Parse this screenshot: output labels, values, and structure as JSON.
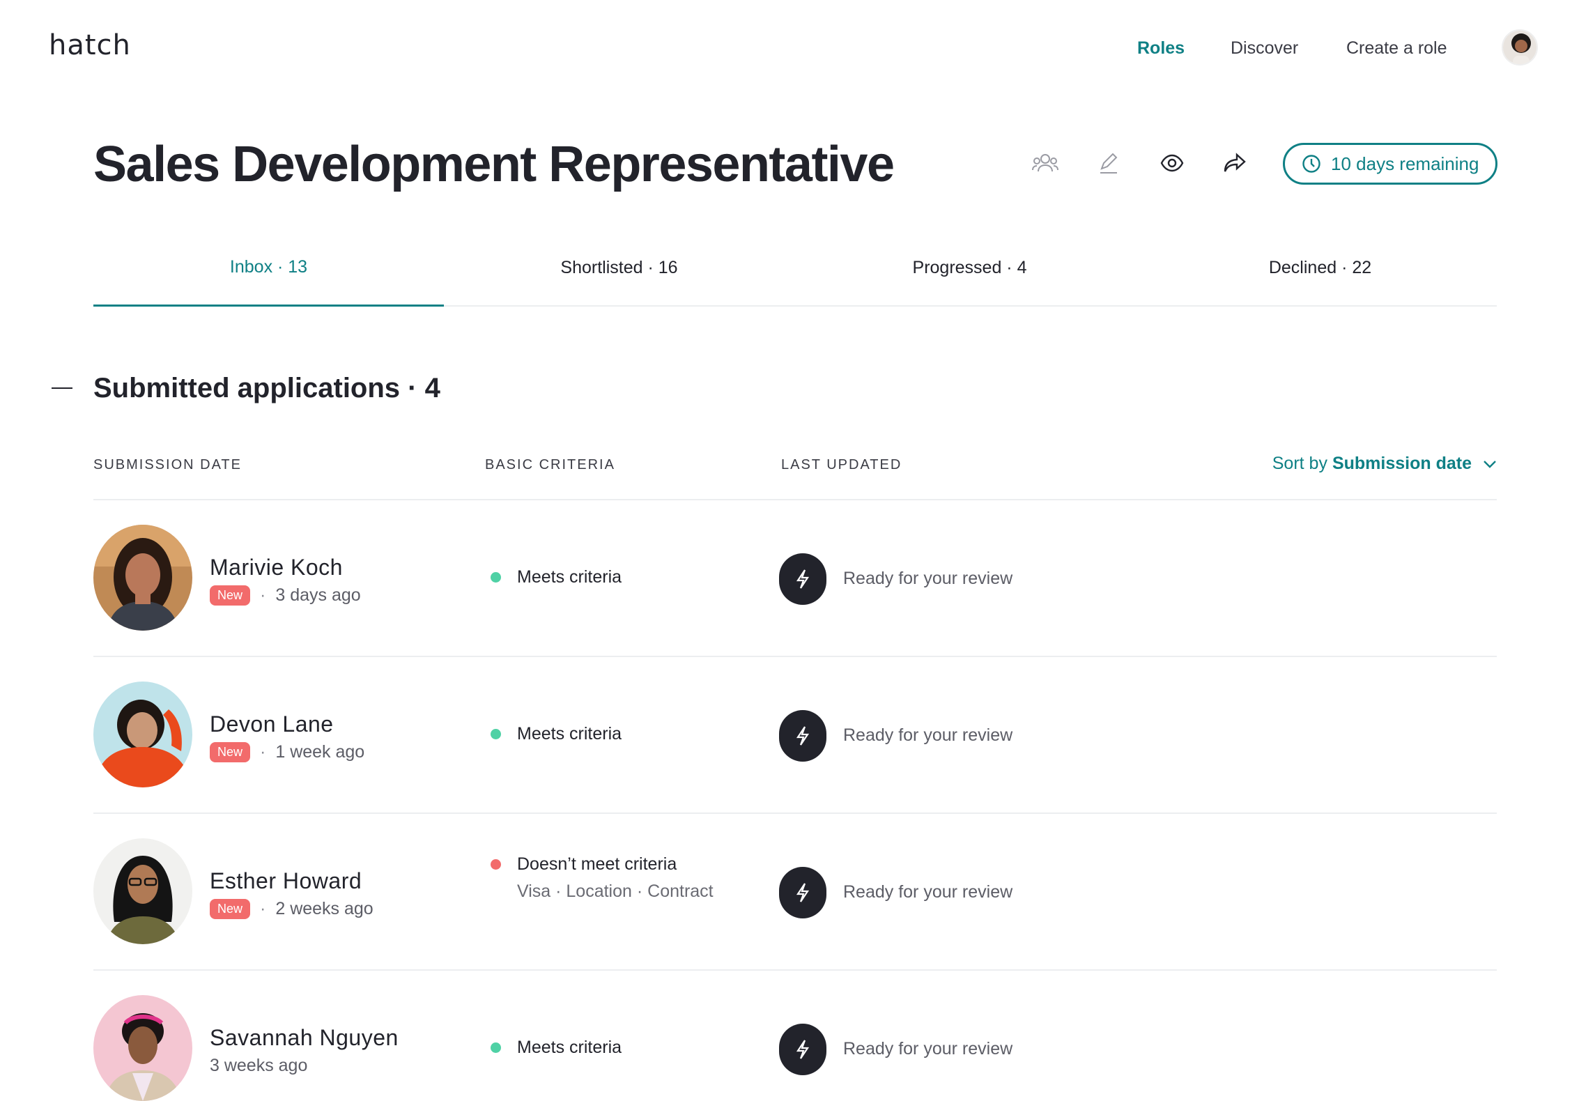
{
  "app": {
    "logo": "hatch"
  },
  "nav": {
    "items": [
      {
        "label": "Roles",
        "active": true
      },
      {
        "label": "Discover",
        "active": false
      },
      {
        "label": "Create a role",
        "active": false
      }
    ],
    "avatar_icon": "user-avatar"
  },
  "role": {
    "title": "Sales Development Representative",
    "actions": [
      "team-icon",
      "edit-icon",
      "preview-icon",
      "share-icon"
    ],
    "remaining": "10 days remaining"
  },
  "tabs": [
    {
      "label": "Inbox · 13",
      "active": true
    },
    {
      "label": "Shortlisted · 16",
      "active": false
    },
    {
      "label": "Progressed · 4",
      "active": false
    },
    {
      "label": "Declined · 22",
      "active": false
    }
  ],
  "section": {
    "title": "Submitted applications · 4",
    "columns": [
      "SUBMISSION DATE",
      "BASIC CRITERIA",
      "LAST UPDATED"
    ],
    "sort_prefix": "Sort by",
    "sort_value": "Submission date"
  },
  "badge_label": "New",
  "separator": "·",
  "colors": {
    "accent": "#0f8085",
    "meets": "#4fd1a5",
    "fails": "#f26b6b",
    "badge": "#f26b6b"
  },
  "applicants": [
    {
      "name": "Marivie Koch",
      "is_new": true,
      "time": "3 days ago",
      "criteria": "Meets criteria",
      "criteria_met": true,
      "criteria_detail": "",
      "status": "Ready for your review"
    },
    {
      "name": "Devon Lane",
      "is_new": true,
      "time": "1 week ago",
      "criteria": "Meets criteria",
      "criteria_met": true,
      "criteria_detail": "",
      "status": "Ready for your review"
    },
    {
      "name": "Esther Howard",
      "is_new": true,
      "time": "2 weeks ago",
      "criteria": "Doesn’t meet criteria",
      "criteria_met": false,
      "criteria_detail": "Visa · Location · Contract",
      "status": "Ready for your review"
    },
    {
      "name": "Savannah Nguyen",
      "is_new": false,
      "time": "3 weeks ago",
      "criteria": "Meets criteria",
      "criteria_met": true,
      "criteria_detail": "",
      "status": "Ready for your review"
    }
  ]
}
